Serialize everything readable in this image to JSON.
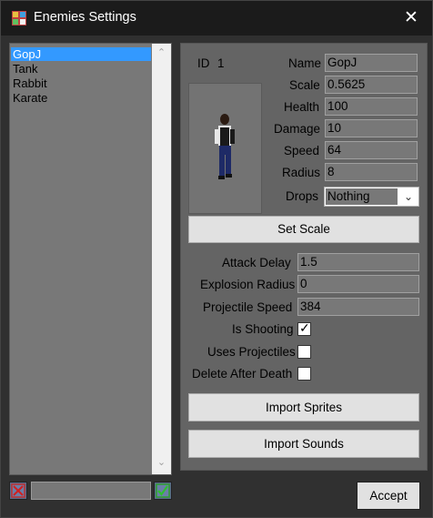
{
  "window": {
    "title": "Enemies Settings",
    "app_icon": "app-icon",
    "close_icon": "close-icon",
    "close_glyph": "✕"
  },
  "enemy_list": {
    "items": [
      "GopJ",
      "Tank",
      "Rabbit",
      "Karate"
    ],
    "selected_index": 0
  },
  "bottom_left": {
    "cancel_icon": "red-x-icon",
    "name_input_value": "",
    "ok_icon": "green-check-icon"
  },
  "details": {
    "id_label": "ID",
    "id_value": "1",
    "sprite_icon": "enemy-sprite-figure",
    "fields": [
      {
        "label": "Name",
        "value": "GopJ"
      },
      {
        "label": "Scale",
        "value": "0.5625"
      },
      {
        "label": "Health",
        "value": "100"
      },
      {
        "label": "Damage",
        "value": "10"
      },
      {
        "label": "Speed",
        "value": "64"
      },
      {
        "label": "Radius",
        "value": "8"
      }
    ],
    "drops": {
      "label": "Drops",
      "value": "Nothing"
    },
    "set_scale_label": "Set Scale",
    "extra_fields": [
      {
        "label": "Attack Delay",
        "value": "1.5"
      },
      {
        "label": "Explosion Radius",
        "value": "0"
      },
      {
        "label": "Projectile Speed",
        "value": "384"
      }
    ],
    "checkboxes": [
      {
        "label": "Is Shooting",
        "checked": true
      },
      {
        "label": "Uses Projectiles",
        "checked": false
      },
      {
        "label": "Delete After Death",
        "checked": false
      }
    ],
    "import_sprites_label": "Import Sprites",
    "import_sounds_label": "Import Sounds"
  },
  "accept_label": "Accept",
  "colors": {
    "selection": "#3399ff",
    "panel": "#646464",
    "field": "#787878",
    "title_bar": "#1b1b1b"
  }
}
